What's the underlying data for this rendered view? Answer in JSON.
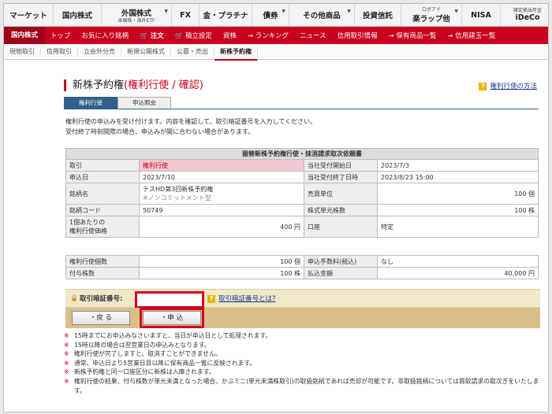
{
  "topnav": [
    {
      "label": "マーケット",
      "sub": ""
    },
    {
      "label": "国内株式",
      "sub": ""
    },
    {
      "label": "外国株式",
      "sub": "米国株・海外ETF"
    },
    {
      "label": "FX",
      "sub": ""
    },
    {
      "label": "金・プラチナ",
      "sub": ""
    },
    {
      "label": "債券",
      "sub": ""
    },
    {
      "label": "その他商品",
      "sub": ""
    },
    {
      "label": "投資信託",
      "sub": ""
    },
    {
      "label": "楽ラップ他",
      "sub": "ロボアド"
    },
    {
      "label": "NISA",
      "sub": ""
    },
    {
      "label": "iDeCo",
      "sub": "確定拠出年金"
    }
  ],
  "redbar": {
    "section": "国内株式",
    "items": [
      "トップ",
      "お気に入り銘柄",
      "🛒 注文",
      "🛒 積立設定",
      "資株",
      "→ ランキング",
      "ニュース",
      "信用取引情報",
      "→ 保有商品一覧",
      "→ 信用建玉一覧"
    ]
  },
  "subnav": [
    "現物取引",
    "信用取引",
    "立会外分売",
    "新規公開株式",
    "公募・売出",
    "新株予約権"
  ],
  "title": {
    "main": "新株予約権",
    "paren": "(権利行使 / 確認)"
  },
  "help_link": "権利行使の方法",
  "tabs": [
    "権利行使",
    "申込照会"
  ],
  "desc": {
    "line1": "権利行使の申込みを受け付けます。内容を確認して、取引暗証番号を入力してください。",
    "line2": "受付終了時刻間際の場合、申込みが間に合わない場合があります。"
  },
  "table1": {
    "header": "振替新株予約権行使・抹消請求取次依頼書",
    "r1": {
      "l1": "取引",
      "v1": "権利行使",
      "l2": "当社受付開始日",
      "v2": "2023/7/3"
    },
    "r2": {
      "l1": "申込日",
      "v1": "2023/7/10",
      "l2": "当社受付終了日時",
      "v2": "2023/8/23 15:00"
    },
    "r3": {
      "l1": "銘柄名",
      "v1": "テスHD第3回新株予約権",
      "v1note": "※ノンコミットメント型",
      "l2": "売買単位",
      "v2": "100 個"
    },
    "r4": {
      "l1": "銘柄コード",
      "v1": "50749",
      "l2": "株式単元株数",
      "v2": "100 株"
    },
    "r5": {
      "l1a": "1個あたりの",
      "l1b": "権利行使価格",
      "v1": "400 円",
      "l2": "口座",
      "v2": "特定"
    }
  },
  "table2": {
    "r1": {
      "l1": "権利行使個数",
      "v1": "100 個",
      "l2": "申込手数料(税込)",
      "v2": "なし"
    },
    "r2": {
      "l1": "付与株数",
      "v1": "100 株",
      "l2": "払込金額",
      "v2": "40,000 円"
    }
  },
  "form": {
    "pin_label": "取引暗証番号:",
    "pin_value": "",
    "help": "取引暗証番号とは?"
  },
  "buttons": {
    "back": "・戻 る",
    "apply": "・申 込"
  },
  "notes": [
    "15時までにお申込みなさいますと、当日が申込日として処理されます。",
    "15時以降の場合は翌営業日の申込みとなります。",
    "権利行使が完了しますと、取消すことができません。",
    "通常、申込日より5営業日目以降に保有商品一覧に反映されます。",
    "新株予約権と同一口座区分に新株は入庫されます。",
    "権利行使の結果、付与株数が単元未満となった場合、かぶミニ(単元未満株取引)の取扱銘柄であれば売却が可能です。非取扱銘柄については買取請求の取次ぎをいたします。"
  ]
}
